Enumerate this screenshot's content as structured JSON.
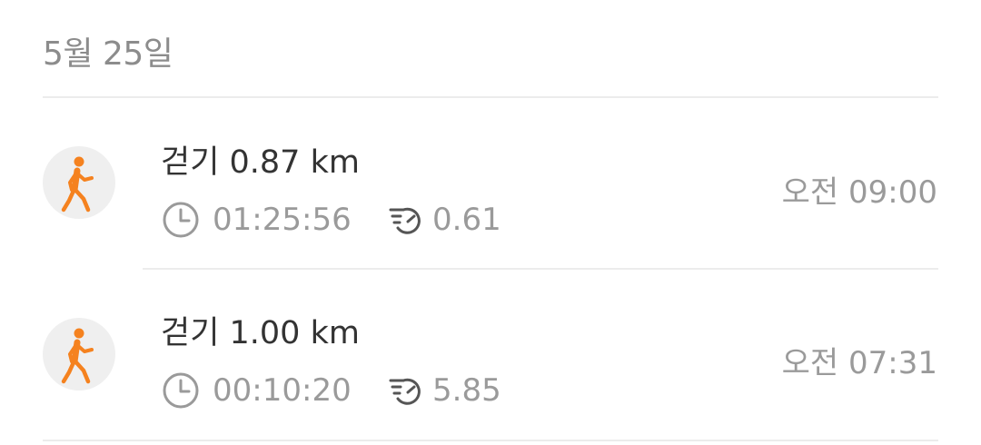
{
  "date_header": "5월 25일",
  "entries": [
    {
      "activity_icon": "walking-person-icon",
      "title": "걷기 0.87 km",
      "duration": "01:25:56",
      "pace": "0.61",
      "time": "오전 09:00"
    },
    {
      "activity_icon": "walking-person-icon",
      "title": "걷기 1.00 km",
      "duration": "00:10:20",
      "pace": "5.85",
      "time": "오전 07:31"
    }
  ],
  "colors": {
    "accent": "#f5821f",
    "muted_text": "#9a9a9a",
    "primary_text": "#333333",
    "divider": "#ececec",
    "avatar_bg": "#efefef"
  }
}
